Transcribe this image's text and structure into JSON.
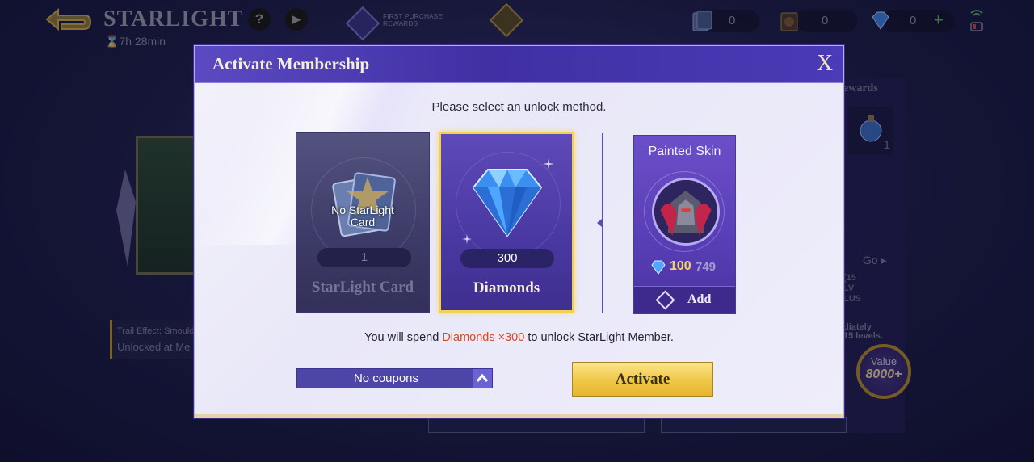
{
  "background": {
    "title": "STARLIGHT",
    "timer": "7h  28min",
    "help_icon": "question-mark-icon",
    "play_icon": "play-icon",
    "first_purchase_label": "FIRST PURCHASE REWARDS",
    "currencies": [
      {
        "icon": "starlight-card-icon",
        "value": "0"
      },
      {
        "icon": "ticket-card-icon",
        "value": "0"
      },
      {
        "icon": "diamond-icon",
        "value": "0"
      }
    ],
    "add_currency_label": "+",
    "rewards_label": "ewards",
    "reward_count": "1",
    "go_label": "Go",
    "trail_effect": "Trail Effect: Smoulde",
    "unlocked_at": "Unlocked at Me",
    "immediately_text": "diately",
    "levels_text": "15 levels.",
    "value_label": "Value",
    "value_amount": "8000+"
  },
  "modal": {
    "title": "Activate Membership",
    "close_label": "X",
    "instruction": "Please select an unlock method.",
    "options": [
      {
        "label": "StarLight Card",
        "count": "1",
        "note": "No StarLight Card",
        "selected": false
      },
      {
        "label": "Diamonds",
        "count": "300",
        "selected": true
      }
    ],
    "skin": {
      "title": "Painted Skin",
      "price_now": "100",
      "price_was": "749",
      "add_label": "Add"
    },
    "spend_prefix": "You will spend ",
    "spend_highlight": "Diamonds ×300",
    "spend_suffix": " to unlock StarLight Member.",
    "coupon_label": "No coupons",
    "activate_label": "Activate"
  },
  "colors": {
    "accent_gold": "#f0c94a",
    "header_purple": "#4030a4",
    "highlight_red": "#d24a22"
  }
}
